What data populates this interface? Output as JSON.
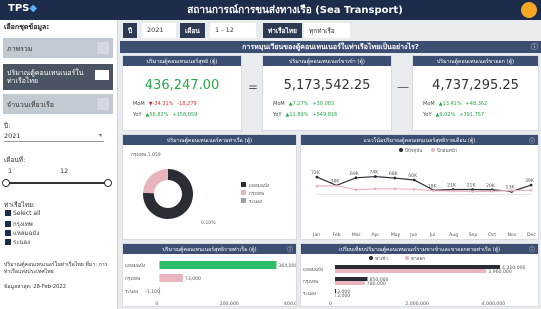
{
  "app": {
    "logo": "TPS",
    "title": "สถานการณ์การขนส่งทางเรือ (Sea Transport)"
  },
  "sidebar": {
    "heading": "เลือกชุดข้อมูล:",
    "tiles": [
      {
        "label": "ภาพรวม"
      },
      {
        "label": "ปริมาณตู้คอนเทนเนอร์ในท่าเรือไทย"
      },
      {
        "label": "จำนวนเที่ยวเรือ"
      }
    ],
    "year_label": "ปี:",
    "year_value": "2021",
    "month_label": "เดือนที่:",
    "month_min": "1",
    "month_max": "12",
    "port_label": "ท่าเรือไทย:",
    "ports": [
      "Select all",
      "กรุงเทพ",
      "แหลมฉบัง",
      "ระนอง"
    ],
    "source_note": "ปริมาณตู้คอนเทนเนอร์ในท่าเรือไทย ที่มา: การท่าเรือแห่งประเทศไทย",
    "updated_note": "ข้อมูลล่าสุด: 28-Feb-2022"
  },
  "filters": {
    "year_tag": "ปี",
    "year_value": "2021",
    "month_tag": "เดือน",
    "month_value": "1 - 12",
    "port_tag": "ท่าเรือไทย",
    "port_value": "ทุกท่าเรือ"
  },
  "banner": {
    "title": "การหมุนเวียนของตู้คอนเทนเนอร์ในท่าเรือไทยเป็นอย่างไร?",
    "info": "ⓘ"
  },
  "kpi": {
    "total": {
      "title": "ปริมาณตู้คอนเทนเนอร์สุทธิ (ตู้)",
      "value": "436,247.00",
      "mom_label": "MoM",
      "mom_pct": "▼-34.31%",
      "mom_abs": "-18,279",
      "yoy_label": "YoY",
      "yoy_pct": "▲56.82%",
      "yoy_abs": "+158,059",
      "color": "#2aa84a"
    },
    "inbound": {
      "title": "ปริมาณตู้คอนเทนเนอร์ขาเข้า (ตู้)",
      "value": "5,173,542.25",
      "mom_label": "MoM",
      "mom_pct": "▲7.27%",
      "mom_abs": "+30,083",
      "yoy_label": "YoY",
      "yoy_pct": "▲11.89%",
      "yoy_abs": "+549,816"
    },
    "outbound": {
      "title": "ปริมาณตู้คอนเทนเนอร์ขาออก (ตู้)",
      "value": "4,737,295.25",
      "mom_label": "MoM",
      "mom_pct": "▲13.41%",
      "mom_abs": "+48,362",
      "yoy_label": "YoY",
      "yoy_pct": "▲9.02%",
      "yoy_abs": "+391,757"
    }
  },
  "cards": {
    "donut_title": "ปริมาณตู้คอนเทนเนอร์ตามท่าเรือ (ตู้)",
    "trend_title": "แนวโน้มปริมาณตู้คอนเทนเนอร์สุทธิรายเดือน (ตู้)",
    "bar_title": "ปริมาณตู้คอนเทนเนอร์สุทธิรายท่าเรือ (ตู้)",
    "compare_title": "เปรียบเทียบปริมาณตู้คอนเทนเนอร์รวมขาเข้าและขาออกตามท่าเรือ (ตู้)",
    "info": "ⓘ"
  },
  "chart_data": [
    {
      "type": "pie",
      "title": "ปริมาณตู้คอนเทนเนอร์ตามท่าเรือ (ตู้)",
      "labels": [
        "แหลมฉบัง",
        "กรุงเทพ",
        "ระนอง"
      ],
      "values": [
        75.9,
        24.1,
        0.1
      ],
      "colors": [
        "#2a2d34",
        "#e8b4bd",
        "#9aa3ad"
      ],
      "annotations": [
        "กรุงเทพ 1,059",
        "แหลมฉบัง",
        "0.10%"
      ]
    },
    {
      "type": "line",
      "title": "แนวโน้มปริมาณตู้คอนเทนเนอร์สุทธิรายเดือน (ตู้)",
      "categories": [
        "Jan",
        "Feb",
        "Mar",
        "Apr",
        "May",
        "Jun",
        "Jul",
        "Aug",
        "Sep",
        "Oct",
        "Nov",
        "Dec"
      ],
      "series": [
        {
          "name": "ปีปัจจุบัน",
          "values": [
            72,
            38,
            69,
            74,
            68,
            60,
            18,
            21,
            21,
            20,
            13,
            39
          ],
          "color": "#2a2d34"
        },
        {
          "name": "ปีก่อนหน้า",
          "values": [
            35,
            37,
            20,
            24,
            24,
            22,
            16,
            15,
            13,
            14,
            17,
            18
          ],
          "color": "#e8b4bd"
        }
      ],
      "ylim": [
        -120,
        150
      ]
    },
    {
      "type": "bar",
      "title": "ปริมาณตู้คอนเทนเนอร์สุทธิรายท่าเรือ (ตู้)",
      "categories": [
        "แหลมฉบัง",
        "กรุงเทพ",
        "ระนอง"
      ],
      "values": [
        364000,
        73000,
        -1100
      ],
      "colors": [
        "#2fbf6b",
        "#e8b4bd",
        "#e8b4bd"
      ],
      "xlim": [
        -20000,
        400000
      ]
    },
    {
      "type": "bar",
      "title": "เปรียบเทียบปริมาณตู้คอนเทนเนอร์รวมขาเข้าและขาออกตามท่าเรือ (ตู้)",
      "categories": [
        "แหลมฉบัง",
        "กรุงเทพ",
        "ระนอง"
      ],
      "series": [
        {
          "name": "ขาเข้า",
          "values": [
            4320000,
            850000,
            3000
          ],
          "color": "#2a2d34"
        },
        {
          "name": "ขาออก",
          "values": [
            3960000,
            780000,
            2000
          ],
          "color": "#e8b4bd"
        }
      ],
      "xlim": [
        0,
        5000000
      ]
    }
  ]
}
